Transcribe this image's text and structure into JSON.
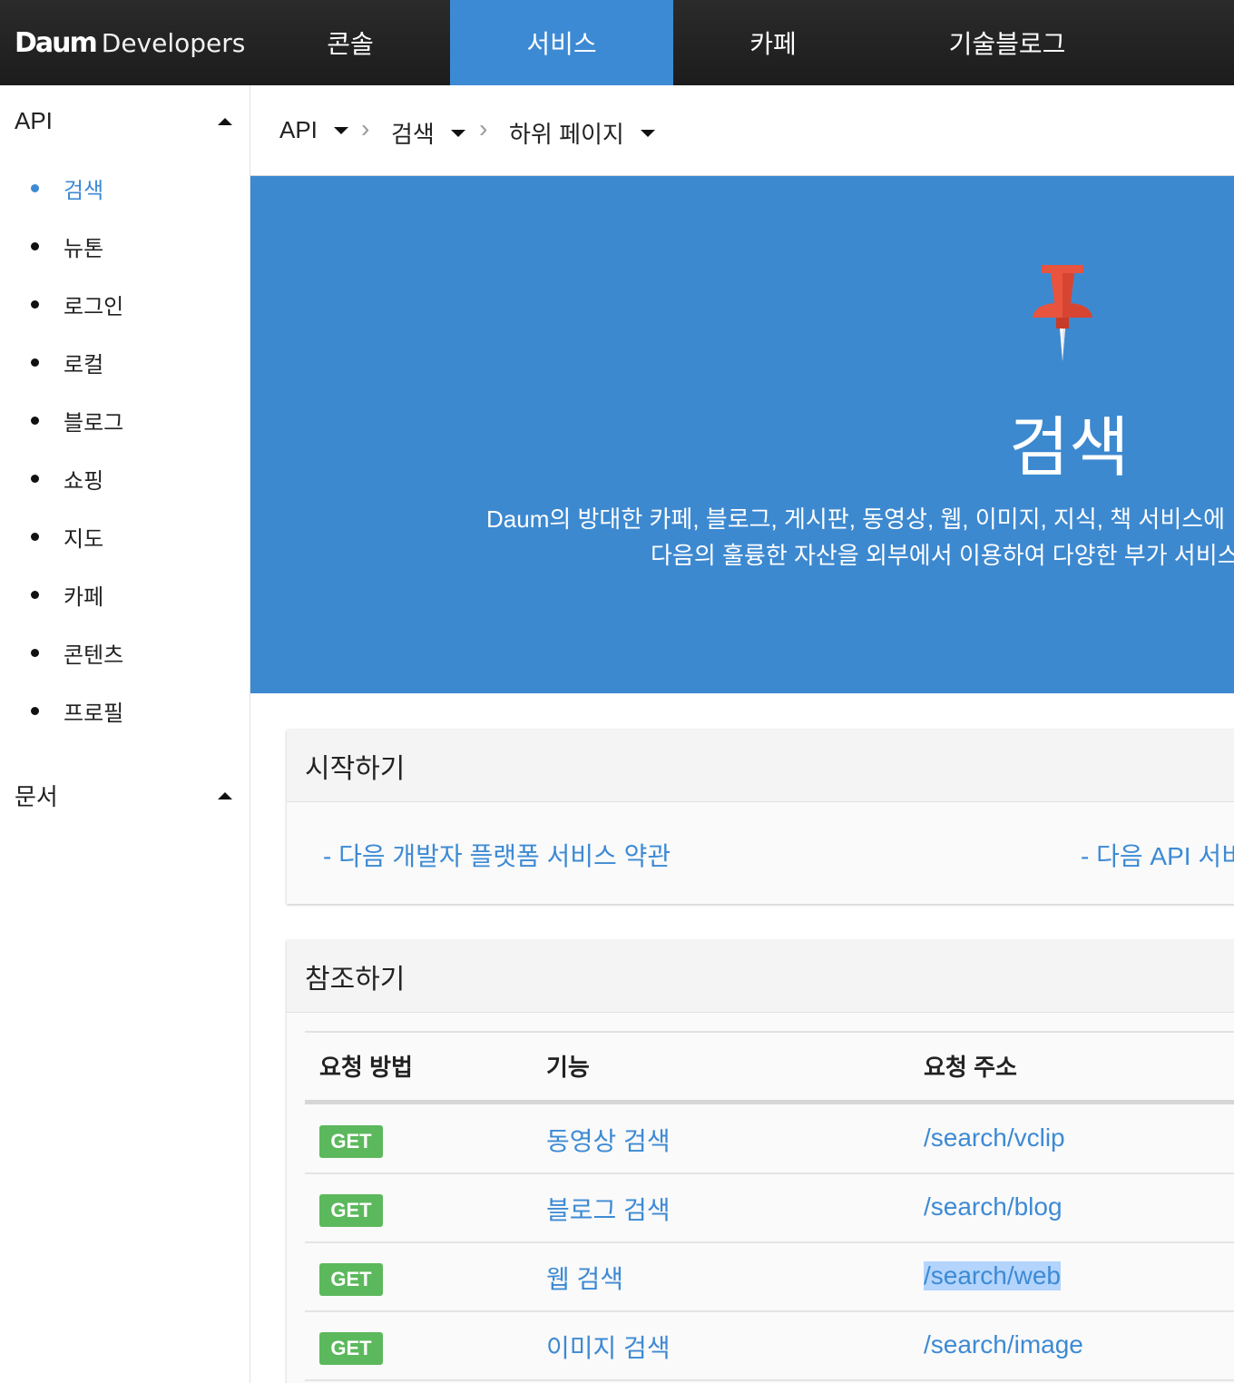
{
  "header": {
    "logo_mark": "Daum",
    "logo_text": "Developers",
    "nav": [
      "콘솔",
      "서비스",
      "카페",
      "기술블로그"
    ],
    "active_nav": "서비스",
    "accent": "#3d8ad4"
  },
  "sidebar": {
    "api_heading": "API",
    "items": [
      "검색",
      "뉴톤",
      "로그인",
      "로컬",
      "블로그",
      "쇼핑",
      "지도",
      "카페",
      "콘텐츠",
      "프로필"
    ],
    "active_item": "검색",
    "docs_heading": "문서"
  },
  "breadcrumb": [
    "API",
    "검색",
    "하위 페이지"
  ],
  "hero": {
    "icon": "pushpin-icon",
    "title": "검색",
    "desc_line1": "Daum의 방대한 카페, 블로그, 게시판, 동영상, 웹, 이미지, 지식, 책 서비스에",
    "desc_line2": "다음의 훌륭한 자산을 외부에서 이용하여 다양한 부가 서비스",
    "bg": "#3d89d0"
  },
  "getting_started": {
    "title": "시작하기",
    "link1": "- 다음 개발자 플랫폼 서비스 약관",
    "link2": "- 다음 API 서비스"
  },
  "reference": {
    "title": "참조하기",
    "headers": [
      "요청 방법",
      "기능",
      "요청 주소"
    ],
    "rows": [
      {
        "method": "GET",
        "feature": "동영상 검색",
        "url": "/search/vclip"
      },
      {
        "method": "GET",
        "feature": "블로그 검색",
        "url": "/search/blog"
      },
      {
        "method": "GET",
        "feature": "웹 검색",
        "url": "/search/web"
      },
      {
        "method": "GET",
        "feature": "이미지 검색",
        "url": "/search/image"
      }
    ],
    "method_color": "#5cb85c"
  }
}
